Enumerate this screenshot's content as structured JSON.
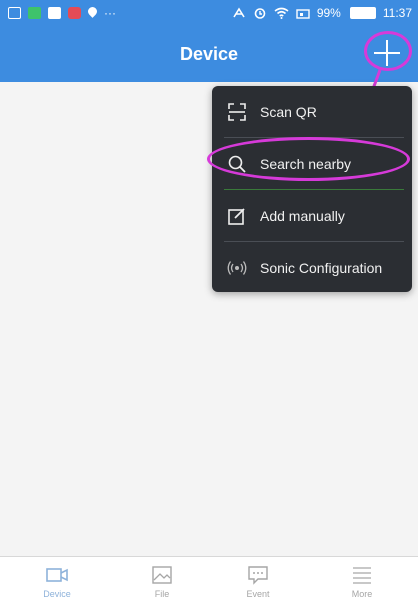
{
  "status_bar": {
    "battery": "99%",
    "time": "11:37",
    "more_dots": "···"
  },
  "app_bar": {
    "title": "Device"
  },
  "menu": {
    "items": [
      {
        "label": "Scan QR",
        "icon": "qr-scan-icon"
      },
      {
        "label": "Search nearby",
        "icon": "search-icon"
      },
      {
        "label": "Add manually",
        "icon": "edit-icon"
      },
      {
        "label": "Sonic Configuration",
        "icon": "sonic-wave-icon"
      }
    ]
  },
  "bottom_nav": {
    "items": [
      {
        "label": "Device",
        "icon": "camera-icon",
        "active": true
      },
      {
        "label": "File",
        "icon": "image-icon",
        "active": false
      },
      {
        "label": "Event",
        "icon": "message-icon",
        "active": false
      },
      {
        "label": "More",
        "icon": "list-icon",
        "active": false
      }
    ]
  },
  "colors": {
    "primary": "#3d8ce0",
    "menu_bg": "#2b2e33",
    "highlight": "#d63ad9",
    "nav_active": "#8eb2da"
  }
}
